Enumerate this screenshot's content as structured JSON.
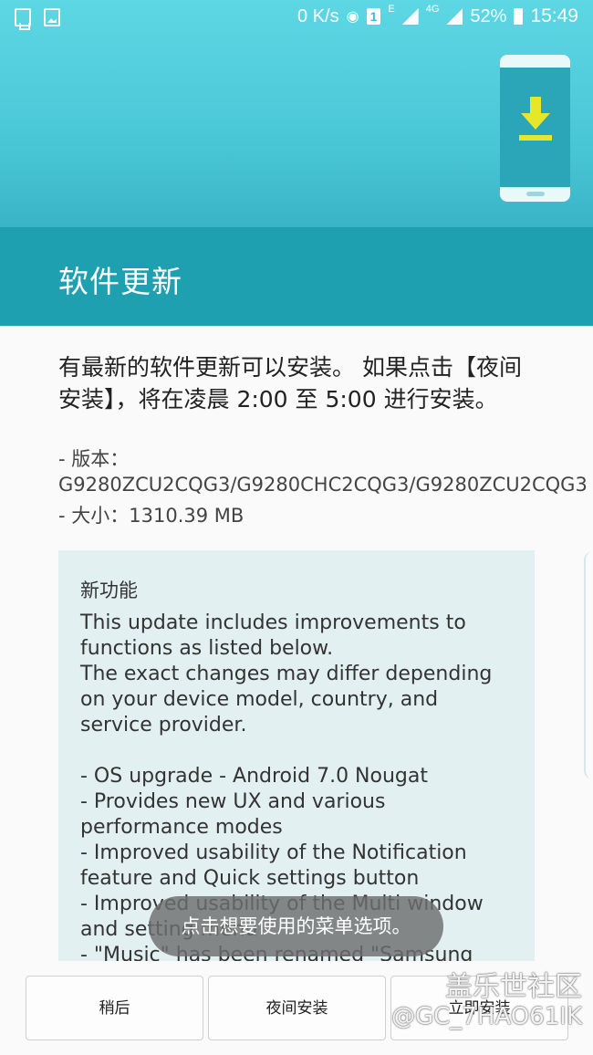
{
  "status_bar": {
    "net_speed": "0 K/s",
    "badge": "1",
    "net_e": "E",
    "net_4g": "4G",
    "battery": "52%",
    "time": "15:49"
  },
  "page": {
    "title": "软件更新",
    "description": "有最新的软件更新可以安装。 如果点击【夜间安装】，将在凌晨 2:00 至 5:00 进行安装。",
    "version_label": " - 版本：G9280ZCU2CQG3/G9280CHC2CQG3/G9280ZCU2CQG3",
    "size_label": " - 大小：1310.39 MB"
  },
  "release_notes": {
    "heading": "新功能",
    "lines": [
      "This update includes improvements to functions as listed below.",
      "The exact changes may differ depending on your device model, country, and service provider.",
      "",
      "- OS upgrade - Android 7.0 Nougat",
      "- Provides new UX and various performance modes",
      "- Improved usability of the Notification feature and Quick settings button",
      "- Improved usability of the Multi window and setting menu",
      "- \"Music\" has been renamed \"Samsung"
    ]
  },
  "toast": {
    "text": "点击想要使用的菜单选项。"
  },
  "buttons": {
    "later": "稍后",
    "night_install": "夜间安装",
    "install_now": "立即安装"
  },
  "watermark": {
    "line1": "盖乐世社区",
    "line2": "@GC_7HAO61IK"
  },
  "colors": {
    "header_top": "#5ed7e4",
    "header_band": "#1ea0b0",
    "notes_bg": "#e3f0f1",
    "arrow": "#e6e62a"
  }
}
